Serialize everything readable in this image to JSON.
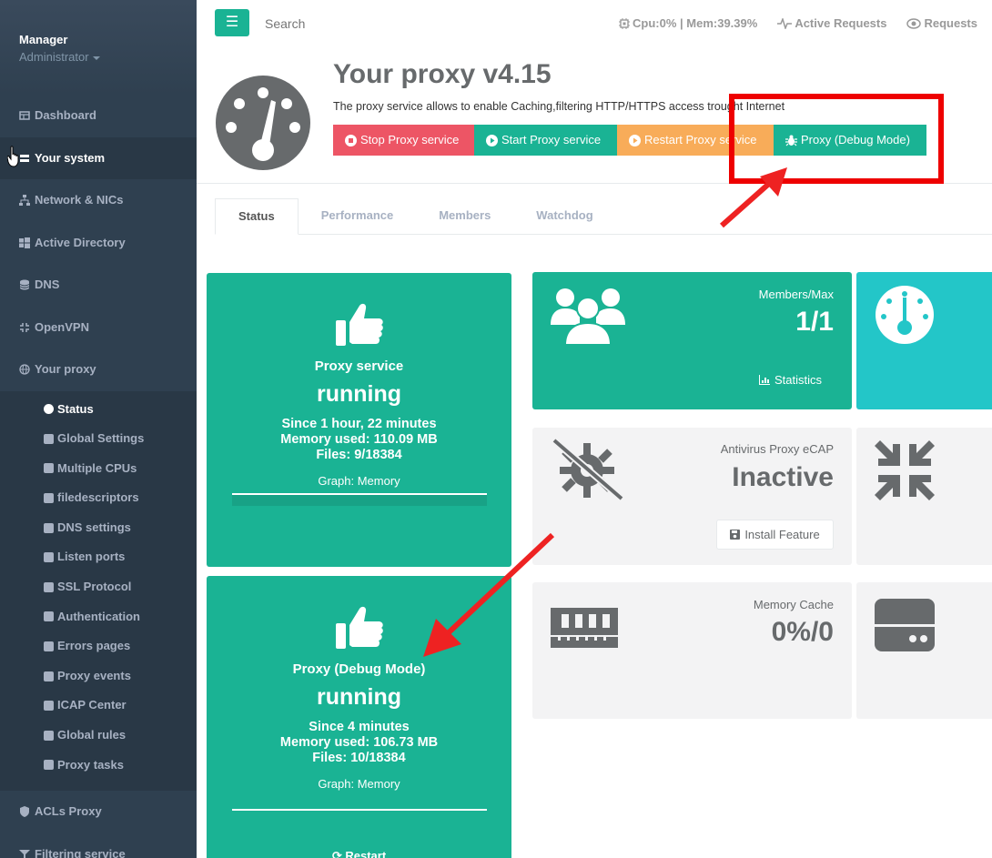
{
  "sidebar": {
    "user": "Manager",
    "role": "Administrator",
    "items": [
      {
        "label": "Dashboard",
        "icon": "dashboard-icon"
      },
      {
        "label": "Your system",
        "icon": "system-icon"
      },
      {
        "label": "Network & NICs",
        "icon": "network-icon"
      },
      {
        "label": "Active Directory",
        "icon": "windows-icon"
      },
      {
        "label": "DNS",
        "icon": "database-icon"
      },
      {
        "label": "OpenVPN",
        "icon": "vpn-icon"
      },
      {
        "label": "Your proxy",
        "icon": "globe-icon"
      }
    ],
    "sub_items": [
      {
        "label": "Status",
        "icon": "tachometer-icon"
      },
      {
        "label": "Global Settings",
        "icon": "cogs-icon"
      },
      {
        "label": "Multiple CPUs",
        "icon": "cpu-icon"
      },
      {
        "label": "filedescriptors",
        "icon": "file-icon"
      },
      {
        "label": "DNS settings",
        "icon": "database-icon"
      },
      {
        "label": "Listen ports",
        "icon": "wrench-icon"
      },
      {
        "label": "SSL Protocol",
        "icon": "ssl-icon"
      },
      {
        "label": "Authentication",
        "icon": "users-icon"
      },
      {
        "label": "Errors pages",
        "icon": "file-text-icon"
      },
      {
        "label": "Proxy events",
        "icon": "eye-icon"
      },
      {
        "label": "ICAP Center",
        "icon": "plug-icon"
      },
      {
        "label": "Global rules",
        "icon": "rules-icon"
      },
      {
        "label": "Proxy tasks",
        "icon": "clock-icon"
      }
    ],
    "bottom_items": [
      {
        "label": "ACLs Proxy",
        "icon": "shield-icon"
      },
      {
        "label": "Filtering service",
        "icon": "filter-icon"
      }
    ]
  },
  "topbar": {
    "menu_icon": "☰",
    "search_placeholder": "Search",
    "cpu_mem": "Cpu:0% | Mem:39.39%",
    "active_requests": "Active Requests",
    "requests": "Requests"
  },
  "header": {
    "title": "Your proxy v4.15",
    "description": "The proxy service allows to enable Caching,filtering HTTP/HTTPS access trought Internet",
    "buttons": {
      "stop": "Stop Proxy service",
      "start": "Start Proxy service",
      "restart": "Restart Proxy service",
      "debug": "Proxy (Debug Mode)"
    }
  },
  "tabs": [
    "Status",
    "Performance",
    "Members",
    "Watchdog"
  ],
  "proxy_card": {
    "title": "Proxy service",
    "status": "running",
    "since": "Since 1 hour, 22 minutes",
    "memory": "Memory used: 110.09 MB",
    "files": "Files: 9/18384",
    "graph": "Graph: Memory"
  },
  "debug_card": {
    "title": "Proxy (Debug Mode)",
    "status": "running",
    "since": "Since 4 minutes",
    "memory": "Memory used: 106.73 MB",
    "files": "Files: 10/18384",
    "graph": "Graph: Memory",
    "restart": "Restart"
  },
  "members_widget": {
    "label": "Members/Max",
    "value": "1/1",
    "link": "Statistics"
  },
  "antivirus_widget": {
    "label": "Antivirus Proxy eCAP",
    "value": "Inactive",
    "button": "Install Feature"
  },
  "cache_widget": {
    "label": "Memory Cache",
    "value": "0%/0"
  },
  "colors": {
    "sidebar": "#2f4050",
    "green": "#1ab394",
    "teal": "#23c6c8",
    "red": "#ed5565",
    "orange": "#f8ac59",
    "annotation_red": "#ee0000"
  }
}
